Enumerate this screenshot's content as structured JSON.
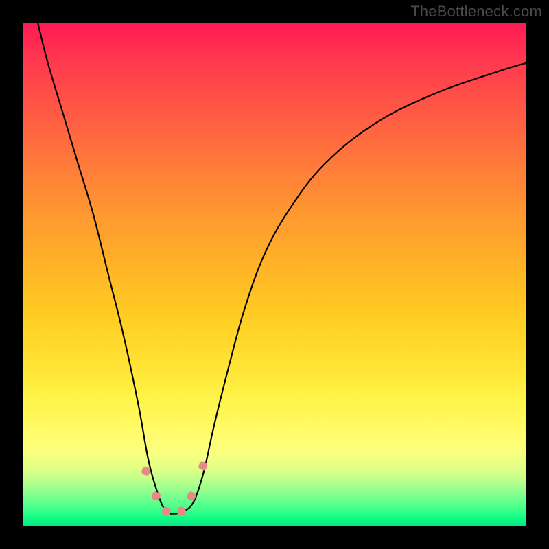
{
  "watermark": "TheBottleneck.com",
  "chart_data": {
    "type": "line",
    "title": "",
    "xlabel": "",
    "ylabel": "",
    "xlim": [
      0,
      100
    ],
    "ylim": [
      0,
      100
    ],
    "series": [
      {
        "name": "bottleneck-curve",
        "x": [
          3,
          5,
          8,
          11,
          14,
          17,
          20,
          23,
          25,
          27,
          28.5,
          30,
          32,
          34,
          36,
          38,
          41,
          44,
          48,
          53,
          60,
          70,
          82,
          95,
          100
        ],
        "y": [
          100,
          92,
          82,
          72,
          62,
          50,
          38,
          24,
          13,
          6,
          3,
          2.5,
          3,
          5,
          11,
          20,
          32,
          43,
          54,
          63,
          72,
          80,
          86,
          90.5,
          92
        ]
      }
    ],
    "markers": [
      {
        "x": 24.5,
        "y": 11,
        "size": 12
      },
      {
        "x": 26.5,
        "y": 6,
        "size": 12
      },
      {
        "x": 28.5,
        "y": 3,
        "size": 12
      },
      {
        "x": 31.5,
        "y": 3,
        "size": 12
      },
      {
        "x": 33.5,
        "y": 6,
        "size": 12
      },
      {
        "x": 35.8,
        "y": 12,
        "size": 12
      }
    ],
    "colors": {
      "curve": "#000000",
      "markers": "#e78a85",
      "gradient_top": "#ff1a55",
      "gradient_bottom": "#00e97e"
    }
  }
}
